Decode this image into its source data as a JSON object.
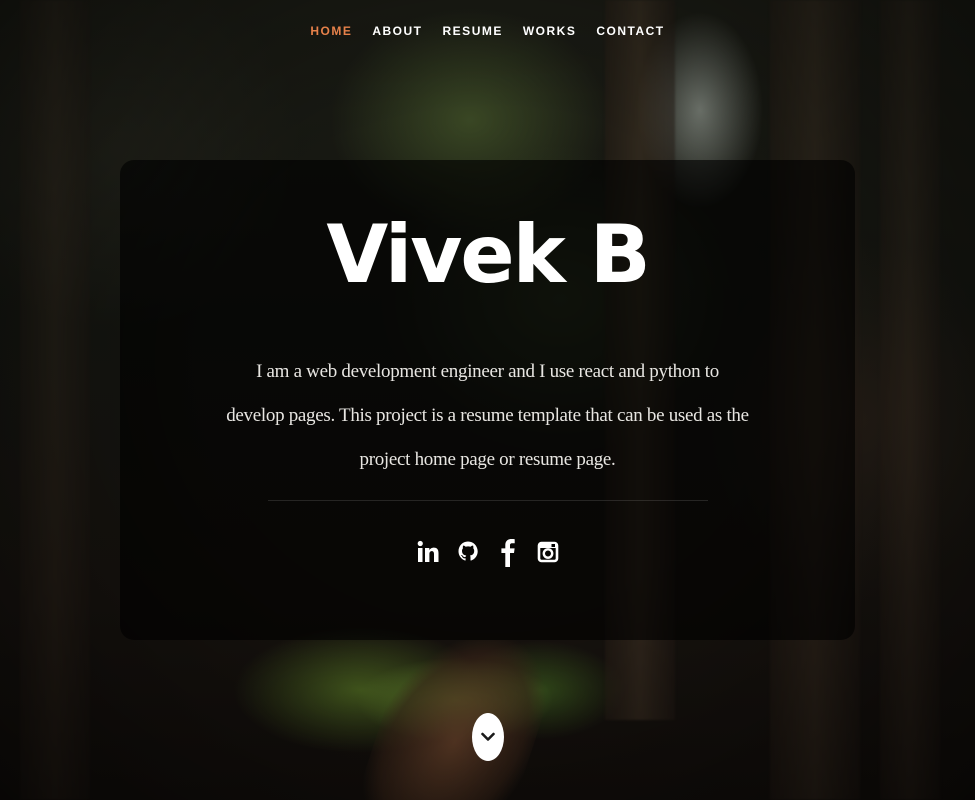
{
  "nav": {
    "items": [
      {
        "label": "HOME",
        "active": true
      },
      {
        "label": "ABOUT",
        "active": false
      },
      {
        "label": "RESUME",
        "active": false
      },
      {
        "label": "WORKS",
        "active": false
      },
      {
        "label": "CONTACT",
        "active": false
      }
    ],
    "active_color": "#e7814a"
  },
  "hero": {
    "name": "Vivek B",
    "bio": "I am a web development engineer and I use react and python to develop pages. This project is a resume template that can be used as the project home page or resume page."
  },
  "social": {
    "icons": [
      "linkedin-icon",
      "github-icon",
      "facebook-icon",
      "instagram-icon"
    ]
  },
  "scroll": {
    "icon": "chevron-down-icon"
  }
}
